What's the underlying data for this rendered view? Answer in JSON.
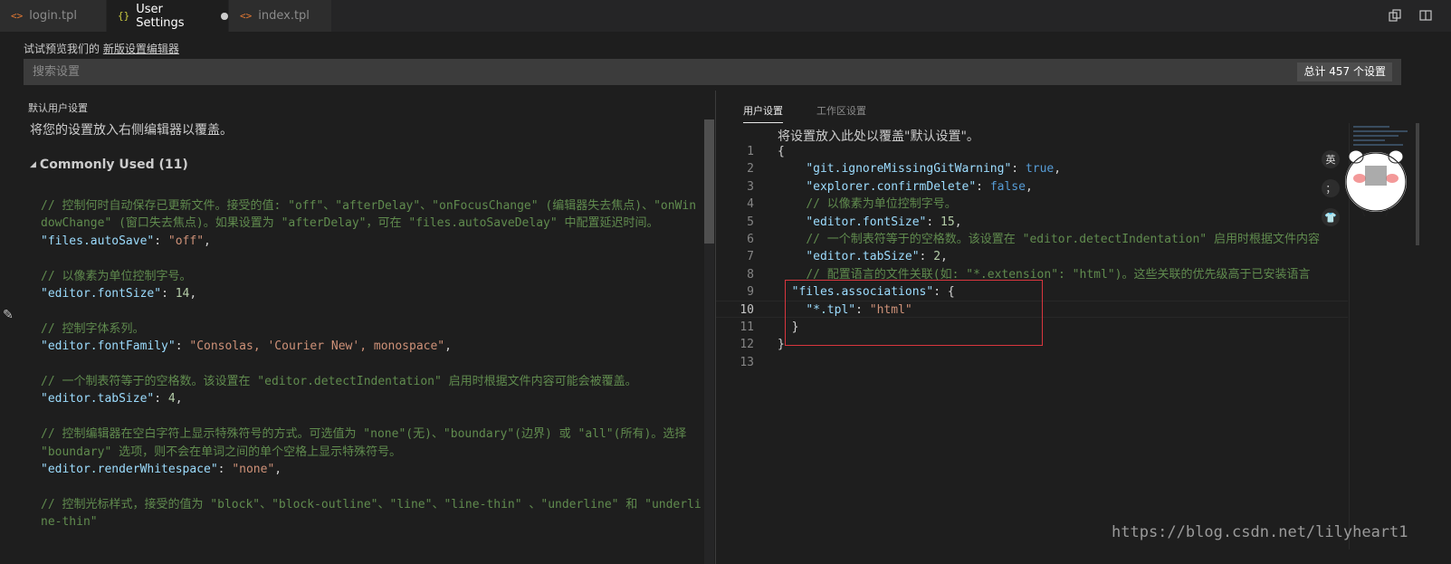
{
  "tabs": [
    {
      "icon": "<>",
      "label": "login.tpl"
    },
    {
      "icon": "{}",
      "label": "User Settings"
    },
    {
      "icon": "<>",
      "label": "index.tpl"
    }
  ],
  "top_actions": {
    "open_settings_json": "open-settings-icon",
    "split_editor": "split-editor-icon"
  },
  "preview": {
    "text": "试试预览我们的",
    "link": "新版设置编辑器"
  },
  "search": {
    "placeholder": "搜索设置",
    "count": "总计 457 个设置"
  },
  "left": {
    "title": "默认用户设置",
    "hint": "将您的设置放入右侧编辑器以覆盖。",
    "section": "Commonly Used (11)",
    "blocks": [
      {
        "comment": "// 控制何时自动保存已更新文件。接受的值: \"off\"、\"afterDelay\"、\"onFocusChange\" (编辑器失去焦点)、\"onWindowChange\" (窗口失去焦点)。如果设置为 \"afterDelay\"，可在 \"files.autoSaveDelay\" 中配置延迟时间。",
        "key": "\"files.autoSave\"",
        "value": "\"off\"",
        "vtype": "str"
      },
      {
        "comment": "// 以像素为单位控制字号。",
        "key": "\"editor.fontSize\"",
        "value": "14",
        "vtype": "num"
      },
      {
        "comment": "// 控制字体系列。",
        "key": "\"editor.fontFamily\"",
        "value": "\"Consolas, 'Courier New', monospace\"",
        "vtype": "str"
      },
      {
        "comment": "// 一个制表符等于的空格数。该设置在 \"editor.detectIndentation\" 启用时根据文件内容可能会被覆盖。",
        "key": "\"editor.tabSize\"",
        "value": "4",
        "vtype": "num"
      },
      {
        "comment": "// 控制编辑器在空白字符上显示特殊符号的方式。可选值为 \"none\"(无)、\"boundary\"(边界) 或 \"all\"(所有)。选择 \"boundary\" 选项，则不会在单词之间的单个空格上显示特殊符号。",
        "key": "\"editor.renderWhitespace\"",
        "value": "\"none\"",
        "vtype": "str"
      },
      {
        "comment": "// 控制光标样式，接受的值为 \"block\"、\"block-outline\"、\"line\"、\"line-thin\" 、\"underline\" 和 \"underline-thin\"",
        "key": "",
        "value": "",
        "vtype": "str"
      }
    ]
  },
  "right": {
    "tab_user": "用户设置",
    "tab_workspace": "工作区设置",
    "hint": "将设置放入此处以覆盖\"默认设置\"。",
    "line_numbers": [
      "1",
      "2",
      "3",
      "4",
      "5",
      "6",
      "7",
      "8",
      "9",
      "10",
      "11",
      "12",
      "13"
    ],
    "current_line": "10",
    "lines": [
      {
        "indent": "",
        "parts": [
          {
            "t": "{",
            "c": "pun"
          }
        ]
      },
      {
        "indent": "    ",
        "parts": [
          {
            "t": "\"git.ignoreMissingGitWarning\"",
            "c": "key"
          },
          {
            "t": ": ",
            "c": "pun"
          },
          {
            "t": "true",
            "c": "bool"
          },
          {
            "t": ",",
            "c": "pun"
          }
        ]
      },
      {
        "indent": "    ",
        "parts": [
          {
            "t": "\"explorer.confirmDelete\"",
            "c": "key"
          },
          {
            "t": ": ",
            "c": "pun"
          },
          {
            "t": "false",
            "c": "bool"
          },
          {
            "t": ",",
            "c": "pun"
          }
        ]
      },
      {
        "indent": "    ",
        "parts": [
          {
            "t": "// 以像素为单位控制字号。",
            "c": "cmt"
          }
        ]
      },
      {
        "indent": "    ",
        "parts": [
          {
            "t": "\"editor.fontSize\"",
            "c": "key"
          },
          {
            "t": ": ",
            "c": "pun"
          },
          {
            "t": "15",
            "c": "num"
          },
          {
            "t": ",",
            "c": "pun"
          }
        ]
      },
      {
        "indent": "    ",
        "parts": [
          {
            "t": "// 一个制表符等于的空格数。该设置在 \"editor.detectIndentation\" 启用时根据文件内容",
            "c": "cmt"
          }
        ]
      },
      {
        "indent": "    ",
        "parts": [
          {
            "t": "\"editor.tabSize\"",
            "c": "key"
          },
          {
            "t": ": ",
            "c": "pun"
          },
          {
            "t": "2",
            "c": "num"
          },
          {
            "t": ",",
            "c": "pun"
          }
        ]
      },
      {
        "indent": "    ",
        "parts": [
          {
            "t": "// 配置语言的文件关联(如: \"*.extension\": \"html\")。这些关联的优先级高于已安装语言",
            "c": "cmt"
          }
        ]
      },
      {
        "indent": "  ",
        "parts": [
          {
            "t": "\"files.associations\"",
            "c": "key"
          },
          {
            "t": ": {",
            "c": "pun"
          }
        ]
      },
      {
        "indent": "    ",
        "parts": [
          {
            "t": "\"*.tpl\"",
            "c": "key"
          },
          {
            "t": ": ",
            "c": "pun"
          },
          {
            "t": "\"html\"",
            "c": "str"
          }
        ]
      },
      {
        "indent": "  ",
        "parts": [
          {
            "t": "}",
            "c": "pun"
          }
        ]
      },
      {
        "indent": "",
        "parts": [
          {
            "t": "}",
            "c": "pun"
          }
        ]
      },
      {
        "indent": "",
        "parts": []
      }
    ]
  },
  "float_buttons": [
    "英",
    "；",
    "👕"
  ],
  "watermark": "https://blog.csdn.net/lilyheart1"
}
